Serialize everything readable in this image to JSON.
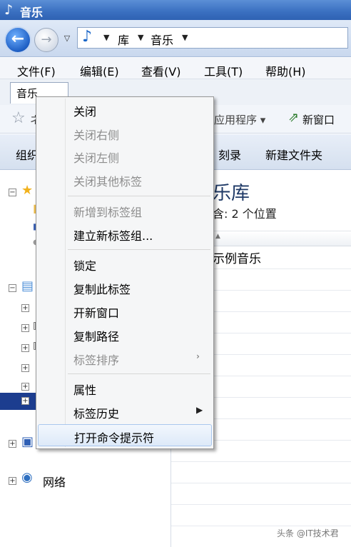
{
  "window": {
    "title": "音乐",
    "title_icon": "music-note-icon"
  },
  "address": {
    "crumbs": [
      "库",
      "音乐"
    ]
  },
  "menubar": {
    "items": [
      "文件(F)",
      "编辑(E)",
      "查看(V)",
      "工具(T)",
      "帮助(H)"
    ]
  },
  "tabs": [
    {
      "label": "音乐"
    }
  ],
  "linkbar": {
    "partial_left": "ネ",
    "app_label": "应用程序",
    "new_window_label": "新窗口"
  },
  "commandbar": {
    "partial_left": "组织",
    "burn_label": "刻录",
    "new_folder_label": "新建文件夹"
  },
  "nav": {
    "network_label": "网络"
  },
  "content": {
    "library_title": "乐库",
    "library_subtitle": "含: 2 个位置",
    "rows": [
      "示例音乐"
    ]
  },
  "context_menu": {
    "items": [
      {
        "label": "关闭",
        "enabled": true
      },
      {
        "label": "关闭右侧",
        "enabled": false
      },
      {
        "label": "关闭左侧",
        "enabled": false
      },
      {
        "label": "关闭其他标签",
        "enabled": false
      },
      {
        "label": "新增到标签组",
        "enabled": false
      },
      {
        "label": "建立新标签组...",
        "enabled": true
      },
      {
        "label": "锁定",
        "enabled": true
      },
      {
        "label": "复制此标签",
        "enabled": true
      },
      {
        "label": "开新窗口",
        "enabled": true
      },
      {
        "label": "复制路径",
        "enabled": true
      },
      {
        "label": "标签排序",
        "enabled": false,
        "submenu": true
      },
      {
        "label": "属性",
        "enabled": true
      },
      {
        "label": "标签历史",
        "enabled": true,
        "submenu": true
      },
      {
        "label": "打开命令提示符",
        "enabled": true,
        "highlighted": true
      }
    ]
  },
  "watermark": "头条 @IT技术君",
  "colors": {
    "title_bar": "#3a6fc0",
    "selection": "#1c3d8f",
    "menu_highlight": "#dde9f8"
  }
}
